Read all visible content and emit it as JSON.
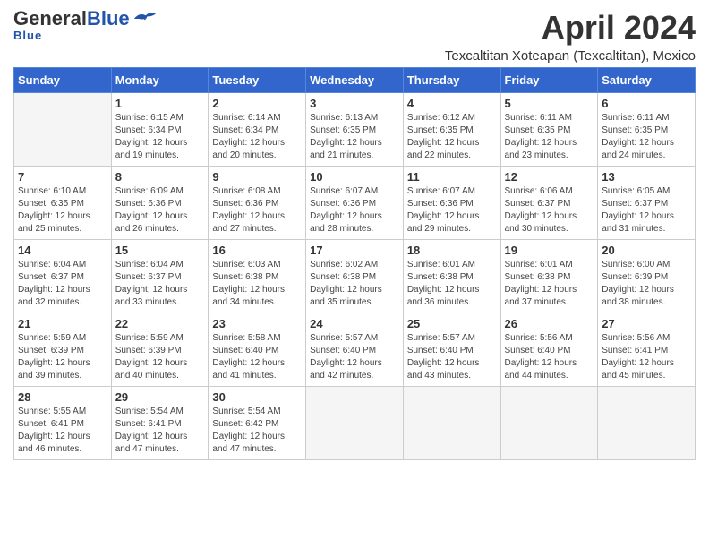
{
  "header": {
    "logo_general": "General",
    "logo_blue": "Blue",
    "month_title": "April 2024",
    "location": "Texcaltitan Xoteapan (Texcaltitan), Mexico"
  },
  "weekdays": [
    "Sunday",
    "Monday",
    "Tuesday",
    "Wednesday",
    "Thursday",
    "Friday",
    "Saturday"
  ],
  "weeks": [
    [
      {
        "day": "",
        "info": ""
      },
      {
        "day": "1",
        "info": "Sunrise: 6:15 AM\nSunset: 6:34 PM\nDaylight: 12 hours\nand 19 minutes."
      },
      {
        "day": "2",
        "info": "Sunrise: 6:14 AM\nSunset: 6:34 PM\nDaylight: 12 hours\nand 20 minutes."
      },
      {
        "day": "3",
        "info": "Sunrise: 6:13 AM\nSunset: 6:35 PM\nDaylight: 12 hours\nand 21 minutes."
      },
      {
        "day": "4",
        "info": "Sunrise: 6:12 AM\nSunset: 6:35 PM\nDaylight: 12 hours\nand 22 minutes."
      },
      {
        "day": "5",
        "info": "Sunrise: 6:11 AM\nSunset: 6:35 PM\nDaylight: 12 hours\nand 23 minutes."
      },
      {
        "day": "6",
        "info": "Sunrise: 6:11 AM\nSunset: 6:35 PM\nDaylight: 12 hours\nand 24 minutes."
      }
    ],
    [
      {
        "day": "7",
        "info": "Sunrise: 6:10 AM\nSunset: 6:35 PM\nDaylight: 12 hours\nand 25 minutes."
      },
      {
        "day": "8",
        "info": "Sunrise: 6:09 AM\nSunset: 6:36 PM\nDaylight: 12 hours\nand 26 minutes."
      },
      {
        "day": "9",
        "info": "Sunrise: 6:08 AM\nSunset: 6:36 PM\nDaylight: 12 hours\nand 27 minutes."
      },
      {
        "day": "10",
        "info": "Sunrise: 6:07 AM\nSunset: 6:36 PM\nDaylight: 12 hours\nand 28 minutes."
      },
      {
        "day": "11",
        "info": "Sunrise: 6:07 AM\nSunset: 6:36 PM\nDaylight: 12 hours\nand 29 minutes."
      },
      {
        "day": "12",
        "info": "Sunrise: 6:06 AM\nSunset: 6:37 PM\nDaylight: 12 hours\nand 30 minutes."
      },
      {
        "day": "13",
        "info": "Sunrise: 6:05 AM\nSunset: 6:37 PM\nDaylight: 12 hours\nand 31 minutes."
      }
    ],
    [
      {
        "day": "14",
        "info": "Sunrise: 6:04 AM\nSunset: 6:37 PM\nDaylight: 12 hours\nand 32 minutes."
      },
      {
        "day": "15",
        "info": "Sunrise: 6:04 AM\nSunset: 6:37 PM\nDaylight: 12 hours\nand 33 minutes."
      },
      {
        "day": "16",
        "info": "Sunrise: 6:03 AM\nSunset: 6:38 PM\nDaylight: 12 hours\nand 34 minutes."
      },
      {
        "day": "17",
        "info": "Sunrise: 6:02 AM\nSunset: 6:38 PM\nDaylight: 12 hours\nand 35 minutes."
      },
      {
        "day": "18",
        "info": "Sunrise: 6:01 AM\nSunset: 6:38 PM\nDaylight: 12 hours\nand 36 minutes."
      },
      {
        "day": "19",
        "info": "Sunrise: 6:01 AM\nSunset: 6:38 PM\nDaylight: 12 hours\nand 37 minutes."
      },
      {
        "day": "20",
        "info": "Sunrise: 6:00 AM\nSunset: 6:39 PM\nDaylight: 12 hours\nand 38 minutes."
      }
    ],
    [
      {
        "day": "21",
        "info": "Sunrise: 5:59 AM\nSunset: 6:39 PM\nDaylight: 12 hours\nand 39 minutes."
      },
      {
        "day": "22",
        "info": "Sunrise: 5:59 AM\nSunset: 6:39 PM\nDaylight: 12 hours\nand 40 minutes."
      },
      {
        "day": "23",
        "info": "Sunrise: 5:58 AM\nSunset: 6:40 PM\nDaylight: 12 hours\nand 41 minutes."
      },
      {
        "day": "24",
        "info": "Sunrise: 5:57 AM\nSunset: 6:40 PM\nDaylight: 12 hours\nand 42 minutes."
      },
      {
        "day": "25",
        "info": "Sunrise: 5:57 AM\nSunset: 6:40 PM\nDaylight: 12 hours\nand 43 minutes."
      },
      {
        "day": "26",
        "info": "Sunrise: 5:56 AM\nSunset: 6:40 PM\nDaylight: 12 hours\nand 44 minutes."
      },
      {
        "day": "27",
        "info": "Sunrise: 5:56 AM\nSunset: 6:41 PM\nDaylight: 12 hours\nand 45 minutes."
      }
    ],
    [
      {
        "day": "28",
        "info": "Sunrise: 5:55 AM\nSunset: 6:41 PM\nDaylight: 12 hours\nand 46 minutes."
      },
      {
        "day": "29",
        "info": "Sunrise: 5:54 AM\nSunset: 6:41 PM\nDaylight: 12 hours\nand 47 minutes."
      },
      {
        "day": "30",
        "info": "Sunrise: 5:54 AM\nSunset: 6:42 PM\nDaylight: 12 hours\nand 47 minutes."
      },
      {
        "day": "",
        "info": ""
      },
      {
        "day": "",
        "info": ""
      },
      {
        "day": "",
        "info": ""
      },
      {
        "day": "",
        "info": ""
      }
    ]
  ]
}
